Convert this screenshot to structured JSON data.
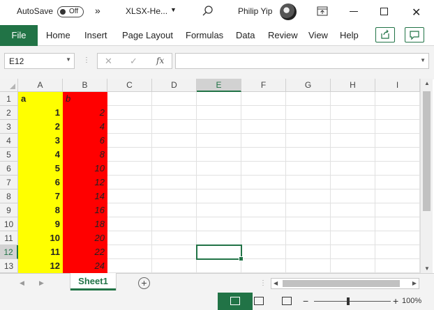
{
  "titlebar": {
    "autosave_label": "AutoSave",
    "autosave_state": "Off",
    "more_glyph": "»",
    "filename": "XLSX-He...",
    "user": "Philip Yip"
  },
  "ribbon": {
    "file": "File",
    "tabs": [
      "Home",
      "Insert",
      "Page Layout",
      "Formulas",
      "Data",
      "Review",
      "View",
      "Help"
    ]
  },
  "formula_bar": {
    "name_box": "E12",
    "formula": ""
  },
  "sheet": {
    "columns": [
      "A",
      "B",
      "C",
      "D",
      "E",
      "F",
      "G",
      "H",
      "I"
    ],
    "rows": [
      "1",
      "2",
      "3",
      "4",
      "5",
      "6",
      "7",
      "8",
      "9",
      "10",
      "11",
      "12",
      "13"
    ],
    "selected_column": "E",
    "selected_row": "12",
    "col_a": [
      "a",
      "1",
      "2",
      "3",
      "4",
      "5",
      "6",
      "7",
      "8",
      "9",
      "10",
      "11",
      "12"
    ],
    "col_b": [
      "b",
      "2",
      "4",
      "6",
      "8",
      "10",
      "12",
      "14",
      "16",
      "18",
      "20",
      "22",
      "24"
    ],
    "col_a_color": "#ffff00",
    "col_b_color": "#ff0000"
  },
  "tabs": {
    "sheet1": "Sheet1",
    "add": "+"
  },
  "status": {
    "zoom": "100%",
    "accent": "#217346"
  }
}
